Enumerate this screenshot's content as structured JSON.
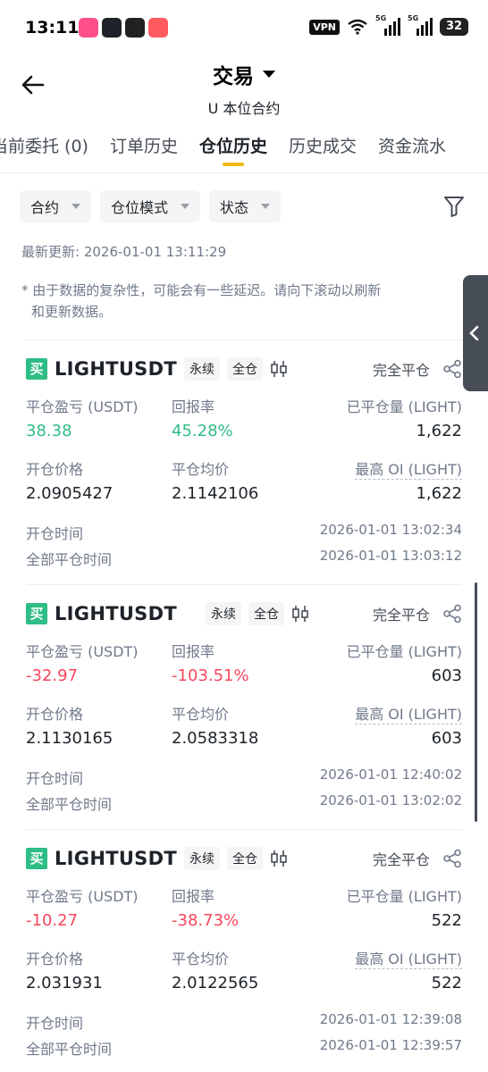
{
  "status_bar": {
    "time": "13:11",
    "vpn": "VPN",
    "signal1_label": "5G",
    "signal2_label": "5G",
    "battery": "32"
  },
  "header": {
    "title": "交易",
    "subtitle": "U 本位合约"
  },
  "tabs": [
    {
      "label": "当前委托 (0)"
    },
    {
      "label": "订单历史"
    },
    {
      "label": "仓位历史"
    },
    {
      "label": "历史成交"
    },
    {
      "label": "资金流水"
    }
  ],
  "filters": [
    {
      "label": "合约"
    },
    {
      "label": "仓位模式"
    },
    {
      "label": "状态"
    }
  ],
  "last_updated": "最新更新: 2026-01-01 13:11:29",
  "notice": {
    "line1": "* 由于数据的复杂性，可能会有一些延迟。请向下滚动以刷新",
    "line2": "和更新数据。"
  },
  "labels": {
    "pnl": "平仓盈亏 (USDT)",
    "roi": "回报率",
    "closed_qty": "已平仓量 (LIGHT)",
    "entry_price": "开仓价格",
    "avg_close_price": "平仓均价",
    "max_oi": "最高 OI (LIGHT)",
    "open_time": "开仓时间",
    "close_time": "全部平仓时间"
  },
  "positions": [
    {
      "side": "买",
      "symbol": "LIGHTUSDT",
      "type_tag": "永续",
      "margin_tag": "全仓",
      "status": "完全平仓",
      "pnl": "38.38",
      "pnl_sign": "positive",
      "roi": "45.28%",
      "closed_qty": "1,622",
      "entry_price": "2.0905427",
      "avg_close_price": "2.1142106",
      "max_oi": "1,622",
      "open_time": "2026-01-01 13:02:34",
      "close_time": "2026-01-01 13:03:12"
    },
    {
      "side": "买",
      "symbol": "LIGHTUSDT",
      "type_tag": "永续",
      "margin_tag": "全仓",
      "status": "完全平仓",
      "pnl": "-32.97",
      "pnl_sign": "negative",
      "roi": "-103.51%",
      "closed_qty": "603",
      "entry_price": "2.1130165",
      "avg_close_price": "2.0583318",
      "max_oi": "603",
      "open_time": "2026-01-01 12:40:02",
      "close_time": "2026-01-01 13:02:02"
    },
    {
      "side": "买",
      "symbol": "LIGHTUSDT",
      "type_tag": "永续",
      "margin_tag": "全仓",
      "status": "完全平仓",
      "pnl": "-10.27",
      "pnl_sign": "negative",
      "roi": "-38.73%",
      "closed_qty": "522",
      "entry_price": "2.031931",
      "avg_close_price": "2.0122565",
      "max_oi": "522",
      "open_time": "2026-01-01 12:39:08",
      "close_time": "2026-01-01 12:39:57"
    }
  ],
  "colors": {
    "accent": "#f0b90b",
    "buy_green": "#2ebd85",
    "loss_red": "#f6465d",
    "muted_text": "#707a8a"
  }
}
